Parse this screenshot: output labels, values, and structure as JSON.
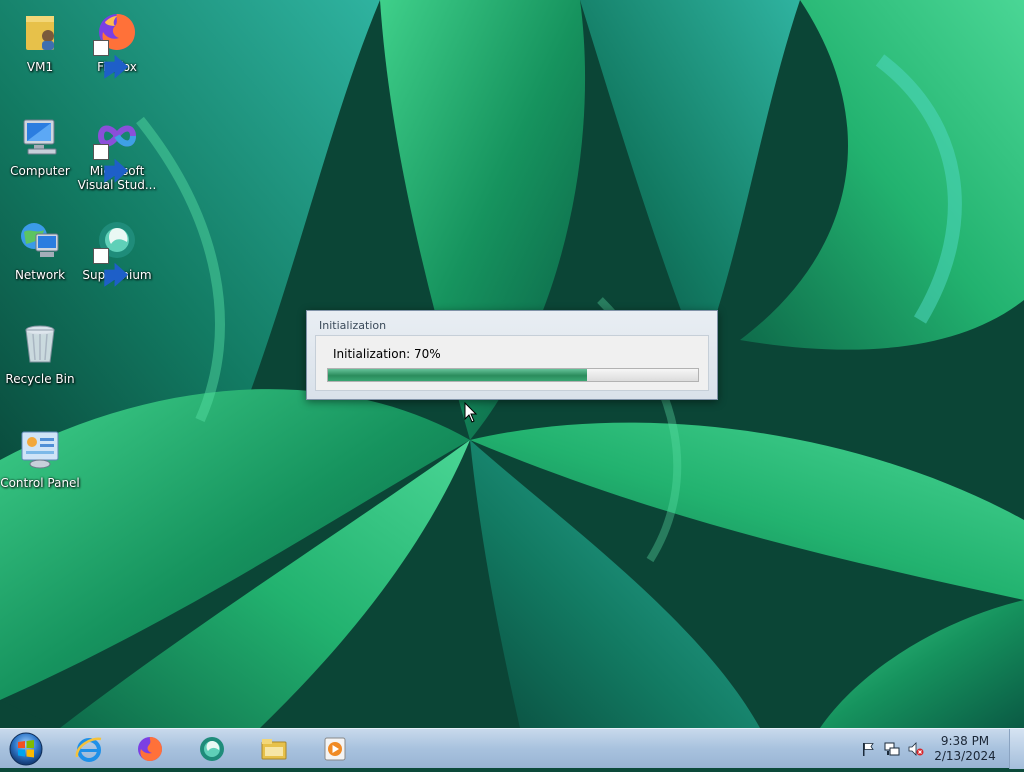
{
  "desktop": {
    "icons": [
      {
        "label": "VM1",
        "icon": "user-folder-icon"
      },
      {
        "label": "Firefox",
        "icon": "firefox-icon"
      },
      {
        "label": "Computer",
        "icon": "computer-icon"
      },
      {
        "label": "Microsoft Visual Stud...",
        "icon": "visual-studio-icon"
      },
      {
        "label": "Network",
        "icon": "network-icon"
      },
      {
        "label": "Supermium",
        "icon": "supermium-icon"
      },
      {
        "label": "Recycle Bin",
        "icon": "recycle-bin-icon"
      },
      {
        "label": "Control Panel",
        "icon": "control-panel-icon"
      }
    ]
  },
  "dialog": {
    "title": "Initialization",
    "status_text": "Initialization: 70%",
    "progress_percent": 70
  },
  "taskbar": {
    "start": "windows-start-orb-icon",
    "pinned": [
      "internet-explorer-icon",
      "firefox-icon",
      "supermium-icon",
      "file-explorer-icon",
      "media-player-icon"
    ],
    "tray": {
      "icons": [
        "action-center-flag-icon",
        "network-tray-icon",
        "volume-muted-icon"
      ],
      "time": "9:38 PM",
      "date": "2/13/2024"
    }
  },
  "colors": {
    "progress_fill": "#2a8c5c",
    "taskbar": "#a8c2de",
    "wallpaper_dark": "#0c4a3a",
    "wallpaper_leaf": "#1fa46a"
  }
}
